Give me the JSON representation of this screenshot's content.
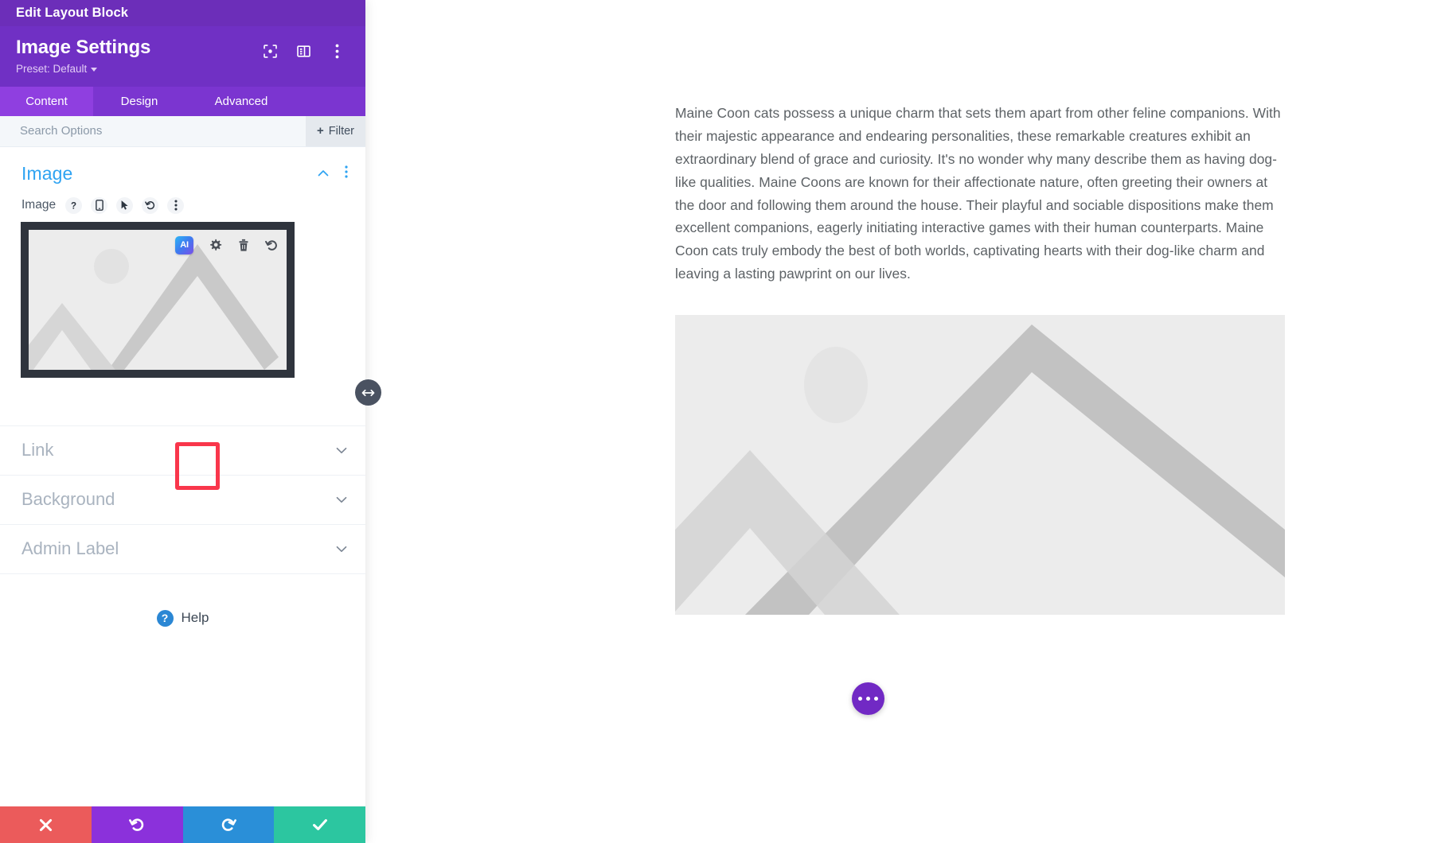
{
  "window": {
    "title": "Edit Layout Block"
  },
  "panel": {
    "heading": "Image Settings",
    "preset_label": "Preset: Default",
    "header_icons": [
      {
        "name": "focus-icon"
      },
      {
        "name": "layout-panel-icon"
      },
      {
        "name": "more-vertical-icon"
      }
    ],
    "tabs": [
      {
        "label": "Content",
        "active": true
      },
      {
        "label": "Design",
        "active": false
      },
      {
        "label": "Advanced",
        "active": false
      }
    ],
    "search": {
      "placeholder": "Search Options",
      "value": ""
    },
    "filter_button": {
      "label": "Filter",
      "plus": "+"
    },
    "image_section": {
      "title": "Image",
      "field_label": "Image",
      "field_icons": [
        {
          "name": "help-question-icon"
        },
        {
          "name": "mobile-responsive-icon"
        },
        {
          "name": "hover-cursor-icon"
        },
        {
          "name": "reset-undo-icon"
        },
        {
          "name": "more-options-icon"
        }
      ],
      "preview_toolbar": [
        {
          "name": "ai-generate-button",
          "label": "AI",
          "highlighted": true
        },
        {
          "name": "settings-gear-icon",
          "label": ""
        },
        {
          "name": "delete-trash-icon",
          "label": ""
        },
        {
          "name": "reset-undo-icon",
          "label": ""
        }
      ]
    },
    "accordions": [
      {
        "label": "Link"
      },
      {
        "label": "Background"
      },
      {
        "label": "Admin Label"
      }
    ],
    "help": {
      "label": "Help",
      "glyph": "?"
    },
    "actions": [
      {
        "name": "cancel-button",
        "icon": "close-x-icon",
        "color": "#eb5b5b"
      },
      {
        "name": "undo-button",
        "icon": "undo-arrow-icon",
        "color": "#8b31db"
      },
      {
        "name": "redo-button",
        "icon": "redo-arrow-icon",
        "color": "#2a8fd8"
      },
      {
        "name": "save-button",
        "icon": "checkmark-icon",
        "color": "#2cc6a0"
      }
    ],
    "resize_handle": {
      "name": "panel-resize-handle"
    }
  },
  "canvas": {
    "paragraph": "Maine Coon cats possess a unique charm that sets them apart from other feline companions. With their majestic appearance and endearing personalities, these remarkable creatures exhibit an extraordinary blend of grace and curiosity. It's no wonder why many describe them as having dog-like qualities. Maine Coons are known for their affectionate nature, often greeting their owners at the door and following them around the house. Their playful and sociable dispositions make them excellent companions, eagerly initiating interactive games with their human counterparts. Maine Coon cats truly embody the best of both worlds, captivating hearts with their dog-like charm and leaving a lasting pawprint on our lives.",
    "hero_image": {
      "name": "image-placeholder",
      "alt": "mountain landscape placeholder"
    },
    "floating_button": {
      "name": "page-settings-fab",
      "icon": "three-dots-icon"
    }
  },
  "colors": {
    "title_bar": "#6c2eb9",
    "header": "#7030c4",
    "tab_bar": "#7b35d0",
    "tab_active": "#8f3fe0",
    "section_title": "#2ea3f2",
    "highlight_box": "#f9364b",
    "fab": "#7129c4"
  }
}
